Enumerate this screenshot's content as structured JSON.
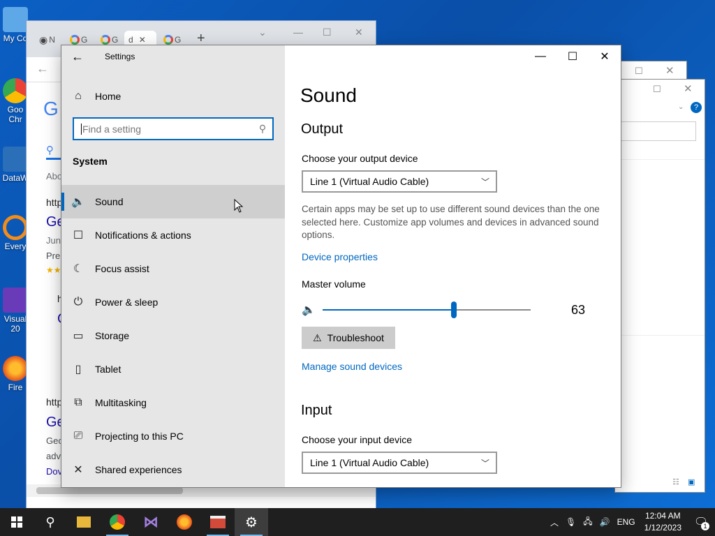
{
  "desktop": {
    "icons": [
      {
        "label": "My Co",
        "name": "this-pc"
      },
      {
        "label": "Goo Chr",
        "name": "chrome"
      },
      {
        "label": "DataW",
        "name": "datawrapper"
      },
      {
        "label": "Every",
        "name": "everything"
      },
      {
        "label": "Visual 20",
        "name": "visual-studio"
      },
      {
        "label": "Fire",
        "name": "firefox"
      }
    ]
  },
  "background_browser": {
    "tabs": [
      "N",
      "G",
      "G",
      "d",
      "G"
    ],
    "new_tab": "+",
    "partial_text": [
      "G",
      "Abo",
      "http",
      "Ge",
      "Jun",
      "Pre",
      "h",
      "G",
      "http",
      "Ge",
      "Geo",
      "adv",
      "Dov"
    ]
  },
  "settings": {
    "app_title": "Settings",
    "home_label": "Home",
    "search_placeholder": "Find a setting",
    "group_title": "System",
    "nav_items": [
      {
        "label": "Sound",
        "icon": "speaker-icon",
        "glyph": "🔈"
      },
      {
        "label": "Notifications & actions",
        "icon": "notifications-icon",
        "glyph": "☐"
      },
      {
        "label": "Focus assist",
        "icon": "moon-icon",
        "glyph": "☾"
      },
      {
        "label": "Power & sleep",
        "icon": "power-icon",
        "glyph": "⏻"
      },
      {
        "label": "Storage",
        "icon": "storage-icon",
        "glyph": "▭"
      },
      {
        "label": "Tablet",
        "icon": "tablet-icon",
        "glyph": "▯"
      },
      {
        "label": "Multitasking",
        "icon": "multitasking-icon",
        "glyph": "⧉"
      },
      {
        "label": "Projecting to this PC",
        "icon": "projecting-icon",
        "glyph": "⎚"
      },
      {
        "label": "Shared experiences",
        "icon": "shared-experiences-icon",
        "glyph": "✕"
      }
    ],
    "selected_nav": "Sound",
    "page_title": "Sound",
    "output": {
      "section_title": "Output",
      "choose_label": "Choose your output device",
      "device": "Line 1 (Virtual Audio Cable)",
      "description": "Certain apps may be set up to use different sound devices than the one selected here. Customize app volumes and devices in advanced sound options.",
      "device_properties_link": "Device properties",
      "master_volume_label": "Master volume",
      "volume_value": "63",
      "volume_fraction": 0.63,
      "troubleshoot_label": "Troubleshoot",
      "manage_link": "Manage sound devices"
    },
    "input": {
      "section_title": "Input",
      "choose_label": "Choose your input device",
      "device": "Line 1 (Virtual Audio Cable)"
    }
  },
  "taskbar": {
    "apps": [
      "start-button",
      "search-button",
      "file-explorer",
      "chrome",
      "visual-studio",
      "firefox",
      "toolbox",
      "settings"
    ],
    "language": "ENG",
    "time": "12:04 AM",
    "date": "1/12/2023",
    "notification_count": "1"
  },
  "colors": {
    "accent": "#0067c0",
    "nav_bg": "#e6e6e6",
    "selected_bg": "#cfcfcf",
    "taskbar": "#1f1f1f",
    "desktop": "#0b5fc4"
  }
}
